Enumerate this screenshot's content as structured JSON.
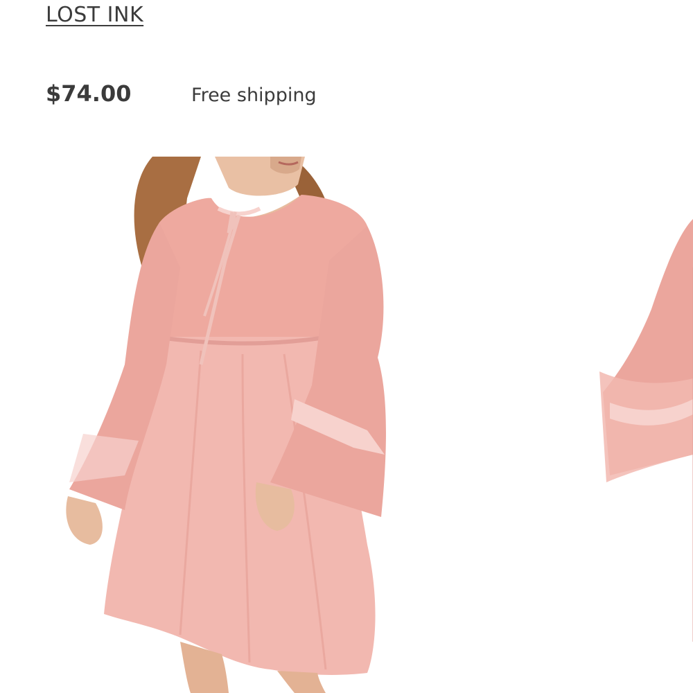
{
  "product": {
    "brand": "LOST INK",
    "price": "$74.00",
    "shipping": "Free shipping"
  },
  "gallery": {
    "images": [
      {
        "icon": "product-photo-main"
      },
      {
        "icon": "product-photo-next"
      }
    ]
  },
  "colors": {
    "text": "#3b3b3b",
    "dress": "#f2b8b0",
    "dress_shadow": "#e29e97",
    "ribbon": "#f7d2cd",
    "skin": "#e7bc9f",
    "hair": "#a86e42"
  }
}
